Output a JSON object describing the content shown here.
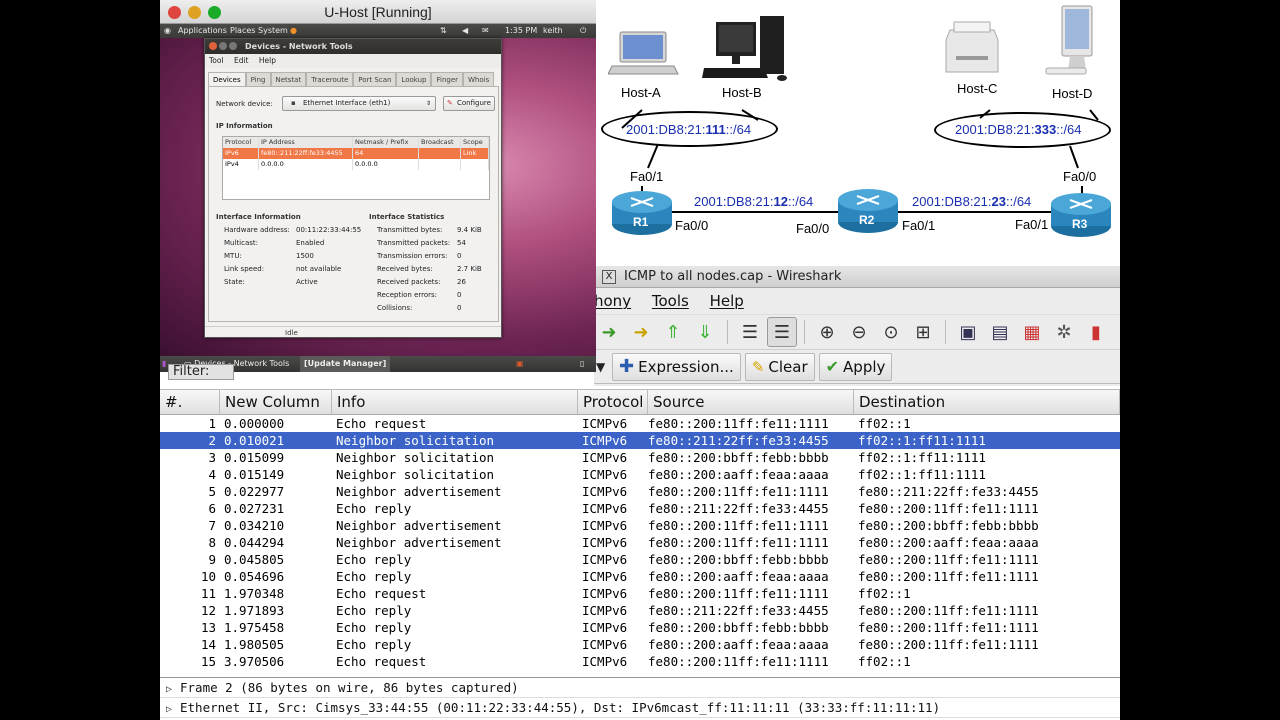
{
  "diagram": {
    "hosts": [
      "Host-A",
      "Host-B",
      "Host-C",
      "Host-D"
    ],
    "lan_left": {
      "prefix": "2001:DB8:21:",
      "bold": "111",
      "suffix": "::/64"
    },
    "lan_right": {
      "prefix": "2001:DB8:21:",
      "bold": "333",
      "suffix": "::/64"
    },
    "link_12": {
      "prefix": "2001:DB8:21:",
      "bold": "12",
      "suffix": "::/64"
    },
    "link_23": {
      "prefix": "2001:DB8:21:",
      "bold": "23",
      "suffix": "::/64"
    },
    "routers": [
      "R1",
      "R2",
      "R3"
    ],
    "interfaces": {
      "r1_up": "Fa0/1",
      "r1_right": "Fa0/0",
      "r2_left": "Fa0/0",
      "r2_right": "Fa0/1",
      "r3_left": "Fa0/1",
      "r3_up": "Fa0/0"
    }
  },
  "vm": {
    "title": "U-Host [Running]",
    "topbar": {
      "applications": "Applications",
      "places": "Places",
      "system": "System",
      "time": "1:35 PM",
      "user": "keith"
    },
    "taskbar": {
      "item1": "Devices - Network Tools",
      "item2": "[Update Manager]"
    },
    "nettools": {
      "title": "Devices - Network Tools",
      "menu": [
        "Tool",
        "Edit",
        "Help"
      ],
      "tabs": [
        "Devices",
        "Ping",
        "Netstat",
        "Traceroute",
        "Port Scan",
        "Lookup",
        "Finger",
        "Whois"
      ],
      "network_device_label": "Network device:",
      "network_device_value": "Ethernet Interface (eth1)",
      "configure_label": "Configure",
      "ip_info_heading": "IP Information",
      "ip_table": {
        "headers": [
          "Protocol",
          "IP Address",
          "Netmask / Prefix",
          "Broadcast",
          "Scope"
        ],
        "rows": [
          [
            "IPv6",
            "fe80::211:22ff:fe33:4455",
            "64",
            "",
            "Link"
          ],
          [
            "IPv4",
            "0.0.0.0",
            "0.0.0.0",
            "",
            ""
          ]
        ]
      },
      "iface_info_heading": "Interface Information",
      "iface_info": [
        [
          "Hardware address:",
          "00:11:22:33:44:55"
        ],
        [
          "Multicast:",
          "Enabled"
        ],
        [
          "MTU:",
          "1500"
        ],
        [
          "Link speed:",
          "not available"
        ],
        [
          "State:",
          "Active"
        ]
      ],
      "iface_stats_heading": "Interface Statistics",
      "iface_stats": [
        [
          "Transmitted bytes:",
          "9.4 KiB"
        ],
        [
          "Transmitted packets:",
          "54"
        ],
        [
          "Transmission errors:",
          "0"
        ],
        [
          "Received bytes:",
          "2.7 KiB"
        ],
        [
          "Received packets:",
          "26"
        ],
        [
          "Reception errors:",
          "0"
        ],
        [
          "Collisions:",
          "0"
        ]
      ],
      "status": "Idle"
    }
  },
  "wireshark": {
    "title": "ICMP to all nodes.cap - Wireshark",
    "menu": [
      "hony",
      "Tools",
      "Help"
    ],
    "filter_label": "Filter:",
    "expression_label": "Expression...",
    "clear_label": "Clear",
    "apply_label": "Apply",
    "columns": [
      "#.",
      "New Column",
      "Info",
      "Protocol",
      "Source",
      "Destination"
    ],
    "packets": [
      [
        "1",
        "0.000000",
        "Echo request",
        "ICMPv6",
        "fe80::200:11ff:fe11:1111",
        "ff02::1"
      ],
      [
        "2",
        "0.010021",
        "Neighbor solicitation",
        "ICMPv6",
        "fe80::211:22ff:fe33:4455",
        "ff02::1:ff11:1111"
      ],
      [
        "3",
        "0.015099",
        "Neighbor solicitation",
        "ICMPv6",
        "fe80::200:bbff:febb:bbbb",
        "ff02::1:ff11:1111"
      ],
      [
        "4",
        "0.015149",
        "Neighbor solicitation",
        "ICMPv6",
        "fe80::200:aaff:feaa:aaaa",
        "ff02::1:ff11:1111"
      ],
      [
        "5",
        "0.022977",
        "Neighbor advertisement",
        "ICMPv6",
        "fe80::200:11ff:fe11:1111",
        "fe80::211:22ff:fe33:4455"
      ],
      [
        "6",
        "0.027231",
        "Echo reply",
        "ICMPv6",
        "fe80::211:22ff:fe33:4455",
        "fe80::200:11ff:fe11:1111"
      ],
      [
        "7",
        "0.034210",
        "Neighbor advertisement",
        "ICMPv6",
        "fe80::200:11ff:fe11:1111",
        "fe80::200:bbff:febb:bbbb"
      ],
      [
        "8",
        "0.044294",
        "Neighbor advertisement",
        "ICMPv6",
        "fe80::200:11ff:fe11:1111",
        "fe80::200:aaff:feaa:aaaa"
      ],
      [
        "9",
        "0.045805",
        "Echo reply",
        "ICMPv6",
        "fe80::200:bbff:febb:bbbb",
        "fe80::200:11ff:fe11:1111"
      ],
      [
        "10",
        "0.054696",
        "Echo reply",
        "ICMPv6",
        "fe80::200:aaff:feaa:aaaa",
        "fe80::200:11ff:fe11:1111"
      ],
      [
        "11",
        "1.970348",
        "Echo request",
        "ICMPv6",
        "fe80::200:11ff:fe11:1111",
        "ff02::1"
      ],
      [
        "12",
        "1.971893",
        "Echo reply",
        "ICMPv6",
        "fe80::211:22ff:fe33:4455",
        "fe80::200:11ff:fe11:1111"
      ],
      [
        "13",
        "1.975458",
        "Echo reply",
        "ICMPv6",
        "fe80::200:bbff:febb:bbbb",
        "fe80::200:11ff:fe11:1111"
      ],
      [
        "14",
        "1.980505",
        "Echo reply",
        "ICMPv6",
        "fe80::200:aaff:feaa:aaaa",
        "fe80::200:11ff:fe11:1111"
      ],
      [
        "15",
        "3.970506",
        "Echo request",
        "ICMPv6",
        "fe80::200:11ff:fe11:1111",
        "ff02::1"
      ]
    ],
    "selected_index": 1,
    "details": [
      "Frame 2 (86 bytes on wire, 86 bytes captured)",
      "Ethernet II, Src: Cimsys_33:44:55 (00:11:22:33:44:55), Dst: IPv6mcast_ff:11:11:11 (33:33:ff:11:11:11)"
    ]
  }
}
